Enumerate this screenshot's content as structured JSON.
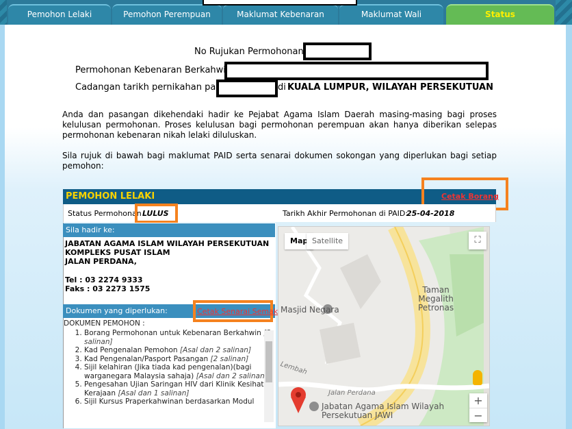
{
  "tabs": [
    "Pemohon Lelaki",
    "Pemohon Perempuan",
    "Maklumat Kebenaran",
    "Maklumat Wali",
    "Status"
  ],
  "active_tab": "Status",
  "summary": {
    "ref_label": "No Rujukan Permohonan:",
    "permission_label": "Permohonan Kebenaran Berkahwin",
    "date_label": "Cadangan tarikh pernikahan pada",
    "location_prefix": "di",
    "location": "KUALA LUMPUR, WILAYAH PERSEKUTUAN"
  },
  "paragraph1": "Anda dan pasangan dikehendaki hadir ke Pejabat Agama Islam Daerah masing-masing bagi proses kelulusan permohonan. Proses kelulusan bagi permohonan perempuan akan hanya diberikan selepas permohonan kebenaran nikah lelaki diluluskan.",
  "paragraph2": "Sila rujuk di bawah bagi maklumat PAID serta senarai dokumen sokongan yang diperlukan bagi setiap pemohon:",
  "section": {
    "title": "PEMOHON LELAKI",
    "print_form": "Cetak Borang",
    "status_label": "Status Permohonan",
    "status_value": "LULUS",
    "deadline_label": "Tarikh Akhir Permohonan di PAID:",
    "deadline_value": "25-04-2018",
    "attend_heading": "Sila hadir ke:",
    "address": [
      "JABATAN AGAMA ISLAM WILAYAH PERSEKUTUAN",
      "KOMPLEKS PUSAT ISLAM",
      "JALAN PERDANA,"
    ],
    "tel": "Tel : 03 2274 9333",
    "fax": "Faks : 03 2273 1575",
    "docs_heading": "Dokumen yang diperlukan:",
    "print_list": "Cetak Senarai Semak",
    "docs_title": "DOKUMEN PEMOHON :",
    "documents": [
      {
        "text": "Borang Permohonan untuk Kebenaran Berkahwin",
        "note": "[2 salinan]"
      },
      {
        "text": "Kad Pengenalan Pemohon",
        "note": "[Asal dan 2 salinan]"
      },
      {
        "text": "Kad Pengenalan/Pasport Pasangan",
        "note": "[2 salinan]"
      },
      {
        "text": "Sijil kelahiran (Jika tiada kad pengenalan)(bagi warganegara Malaysia sahaja)",
        "note": "[Asal dan 2 salinan]"
      },
      {
        "text": "Pengesahan Ujian Saringan HIV dari Klinik Kesihatan Kerajaan",
        "note": "[Asal dan 1 salinan]"
      },
      {
        "text": "Sijil Kursus Praperkahwinan berdasarkan Modul",
        "note": ""
      }
    ]
  },
  "map": {
    "tab_map": "Map",
    "tab_satellite": "Satellite",
    "labels": [
      "Taman",
      "Megalith",
      "Petronas",
      "Masjid Negara",
      "Lembah",
      "Jalan Perdana",
      "Jabatan Agama Islam Wilayah",
      "Persekutuan JAWI"
    ],
    "zoom_in": "+",
    "zoom_out": "−"
  }
}
